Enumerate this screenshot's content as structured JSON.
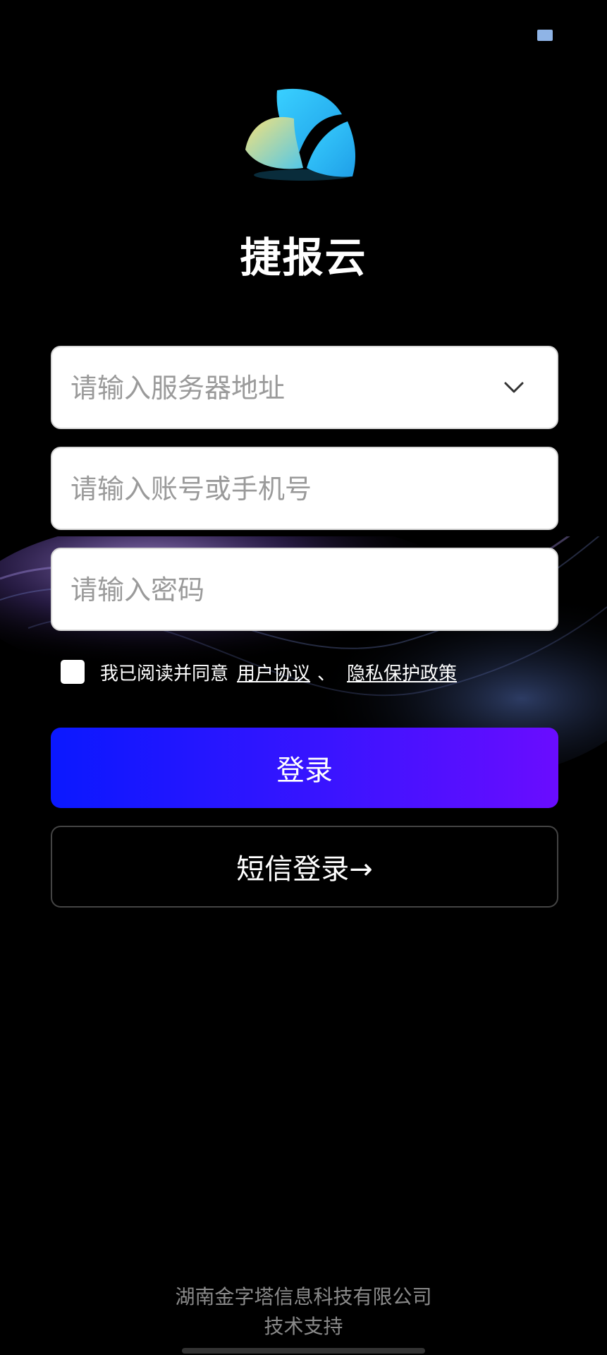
{
  "app": {
    "title": "捷报云"
  },
  "form": {
    "server_placeholder": "请输入服务器地址",
    "account_placeholder": "请输入账号或手机号",
    "password_placeholder": "请输入密码"
  },
  "agreement": {
    "prefix": "我已阅读并同意",
    "user_agreement": "用户协议",
    "separator": "、",
    "privacy_policy": "隐私保护政策",
    "checked": false
  },
  "buttons": {
    "login": "登录",
    "sms_login": "短信登录→"
  },
  "footer": {
    "company": "湖南金字塔信息科技有限公司",
    "support": "技术支持"
  },
  "colors": {
    "background": "#000000",
    "login_gradient_start": "#0a18ff",
    "login_gradient_end": "#6a0cff"
  }
}
